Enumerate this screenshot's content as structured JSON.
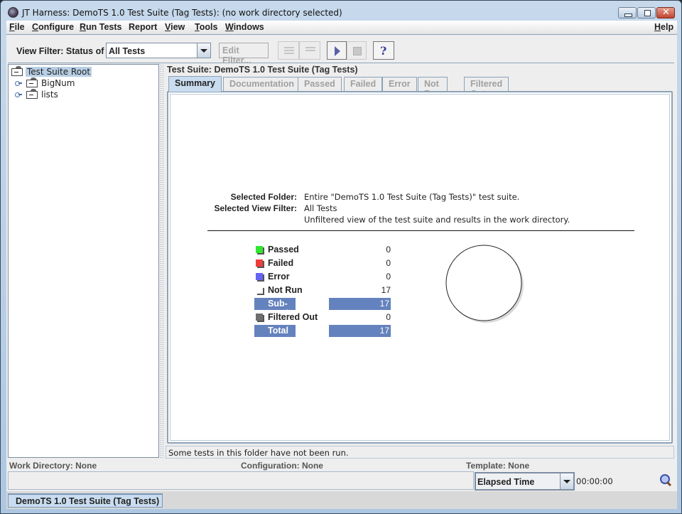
{
  "window": {
    "title": "JT Harness: DemoTS 1.0 Test Suite (Tag Tests): (no work directory selected)",
    "controls": {
      "minimize": "minimize",
      "maximize": "maximize",
      "close": "✕"
    }
  },
  "menubar": {
    "items": [
      {
        "label": "File",
        "mnemonic": "F",
        "rest": "ile"
      },
      {
        "label": "Configure",
        "mnemonic": "C",
        "rest": "onfigure"
      },
      {
        "label": "Run Tests",
        "mnemonic": "R",
        "rest": "un Tests"
      },
      {
        "label": "Report",
        "mnemonic": "",
        "rest": "Report"
      },
      {
        "label": "View",
        "mnemonic": "V",
        "rest": "iew"
      },
      {
        "label": "Tools",
        "mnemonic": "T",
        "rest": "ools"
      },
      {
        "label": "Windows",
        "mnemonic": "W",
        "rest": "indows"
      }
    ],
    "help": {
      "label": "Help",
      "mnemonic": "H",
      "rest": "elp"
    }
  },
  "toolbar": {
    "view_filter_label": "View Filter: Status of",
    "view_filter_value": "All Tests",
    "edit_filter_label": "Edit Filter...",
    "buttons": {
      "expand_all": "expand-all",
      "collapse_all": "collapse-all",
      "start": "start",
      "stop": "stop",
      "help": "?"
    }
  },
  "tree": {
    "root": "Test Suite Root",
    "children": [
      "BigNum",
      "lists"
    ]
  },
  "main": {
    "suite_title": "Test Suite: DemoTS 1.0 Test Suite (Tag Tests)",
    "tabs": [
      {
        "label": "Summary",
        "active": true
      },
      {
        "label": "Documentation",
        "active": false
      },
      {
        "label": "Passed",
        "active": false
      },
      {
        "label": "Failed",
        "active": false
      },
      {
        "label": "Error",
        "active": false
      },
      {
        "label": "Not Run",
        "active": false
      },
      {
        "label": "Filtered Out",
        "active": false
      }
    ],
    "summary": {
      "selected_folder_label": "Selected Folder:",
      "selected_folder_value": "Entire \"DemoTS 1.0 Test Suite (Tag Tests)\" test suite.",
      "selected_view_filter_label": "Selected View Filter:",
      "selected_view_filter_value": "All Tests",
      "selected_view_filter_desc": "Unfiltered view of the test suite and results in the work directory.",
      "stats": [
        {
          "label": "Passed",
          "value": "0",
          "color": "#33e633"
        },
        {
          "label": "Failed",
          "value": "0",
          "color": "#f03c3c"
        },
        {
          "label": "Error",
          "value": "0",
          "color": "#6464f5"
        },
        {
          "label": "Not Run",
          "value": "17",
          "color": "#ffffff"
        }
      ],
      "subtotal": {
        "label": "Sub-Total",
        "value": "17"
      },
      "filtered_out": {
        "label": "Filtered Out",
        "value": "0",
        "color": "#6e6e6e"
      },
      "total": {
        "label": "Total",
        "value": "17"
      },
      "bar_color": "#6482bd"
    },
    "status_message": "Some tests in this folder have not been run."
  },
  "info_bar": {
    "work_directory": "Work Directory: None",
    "configuration": "Configuration: None",
    "template": "Template: None"
  },
  "progress": {
    "mode": "Elapsed Time",
    "elapsed": "00:00:00"
  },
  "bottom_tabs": [
    "DemoTS 1.0 Test Suite (Tag Tests)"
  ]
}
